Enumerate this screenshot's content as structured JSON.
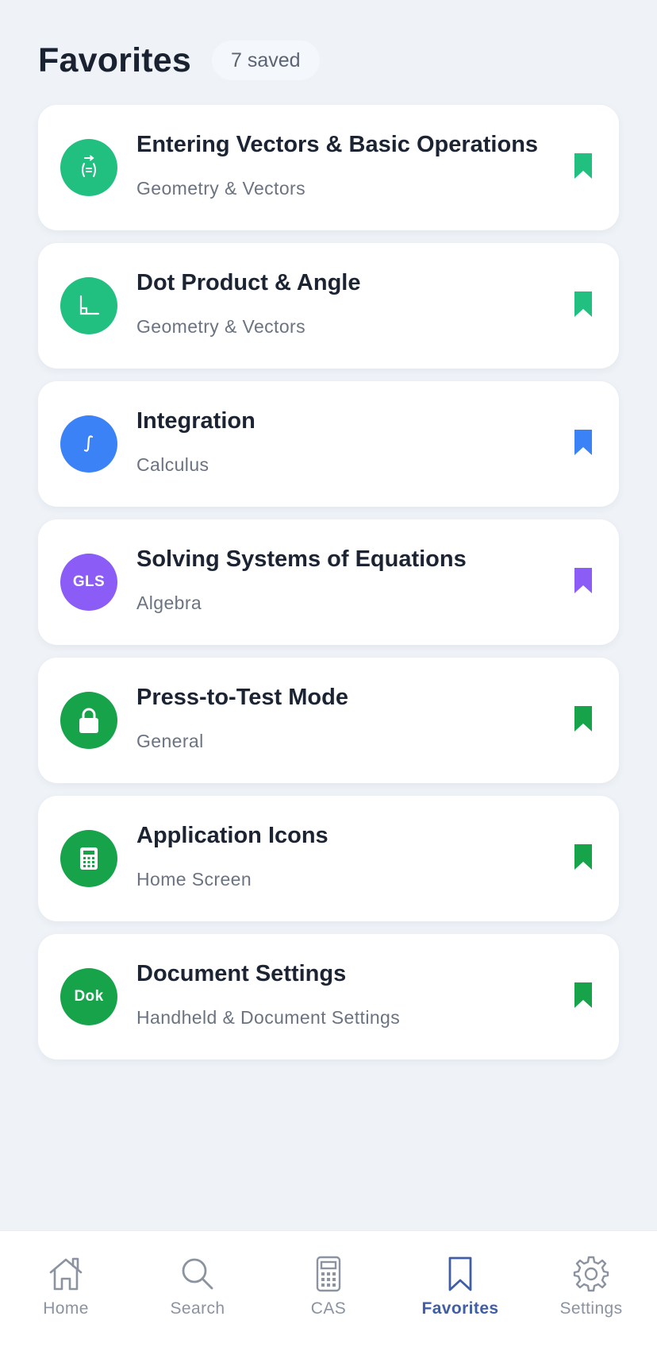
{
  "header": {
    "title": "Favorites",
    "count_badge": "7 saved"
  },
  "favorites": [
    {
      "title": "Entering Vectors & Basic Operations",
      "category": "Geometry & Vectors",
      "icon": "vector-icon",
      "color": "#22c080"
    },
    {
      "title": "Dot Product & Angle",
      "category": "Geometry & Vectors",
      "icon": "angle-icon",
      "color": "#22c080"
    },
    {
      "title": "Integration",
      "category": "Calculus",
      "icon": "integral-icon",
      "color": "#3b82f6"
    },
    {
      "title": "Solving Systems of Equations",
      "category": "Algebra",
      "icon_text": "GLS",
      "color": "#8b5cf6"
    },
    {
      "title": "Press-to-Test Mode",
      "category": "General",
      "icon": "lock-icon",
      "color": "#16a34a"
    },
    {
      "title": "Application Icons",
      "category": "Home Screen",
      "icon": "calculator-icon",
      "color": "#16a34a"
    },
    {
      "title": "Document Settings",
      "category": "Handheld & Document Settings",
      "icon_text": "Dok",
      "color": "#16a34a"
    }
  ],
  "tabbar": {
    "tabs": [
      {
        "label": "Home",
        "icon": "home-icon"
      },
      {
        "label": "Search",
        "icon": "search-icon"
      },
      {
        "label": "CAS",
        "icon": "calculator-icon"
      },
      {
        "label": "Favorites",
        "icon": "bookmark-icon",
        "active": true
      },
      {
        "label": "Settings",
        "icon": "gear-icon"
      }
    ],
    "active_color": "#3f5ea6",
    "inactive_color": "#8b93a0"
  }
}
